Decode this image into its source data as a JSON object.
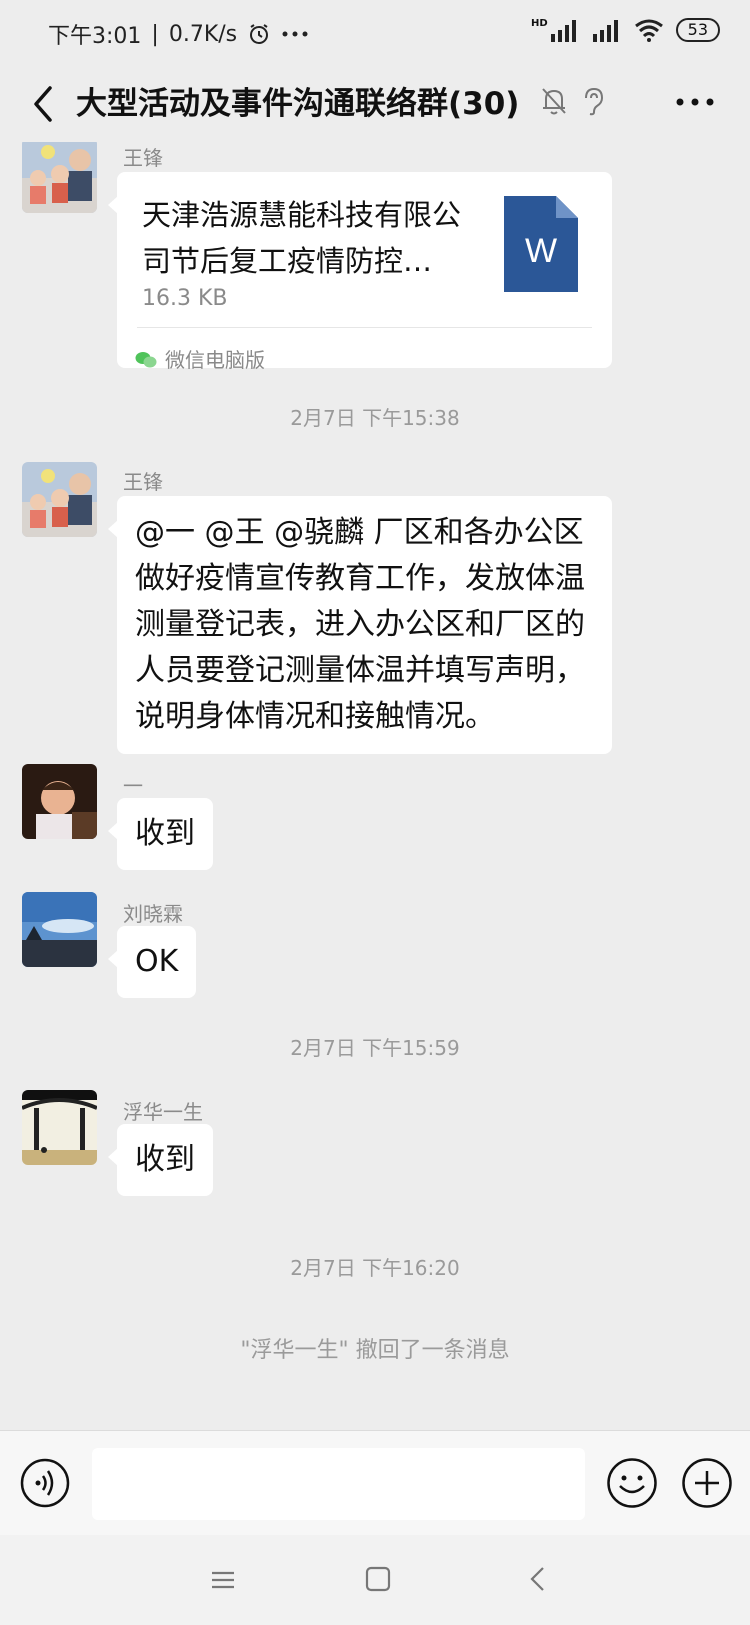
{
  "status_bar": {
    "time": "下午3:01",
    "net_speed": "0.7K/s",
    "hd_label": "HD",
    "battery": "53"
  },
  "header": {
    "title": "大型活动及事件沟通联络群(30)"
  },
  "messages": [
    {
      "sender": "王锋",
      "file_title": "天津浩源慧能科技有限公司节后复工疫情防控…",
      "file_size": "16.3 KB",
      "file_icon_letter": "W",
      "source": "微信电脑版"
    },
    {
      "sender": "王锋",
      "text": "@一 @王 @骁麟 厂区和各办公区做好疫情宣传教育工作，发放体温测量登记表，进入办公区和厂区的人员要登记测量体温并填写声明，说明身体情况和接触情况。"
    },
    {
      "sender": "一",
      "text": "收到"
    },
    {
      "sender": "刘晓霖",
      "text": "OK"
    },
    {
      "sender": "浮华一生",
      "text": "收到"
    }
  ],
  "timestamps": [
    "2月7日 下午15:38",
    "2月7日 下午15:59",
    "2月7日 下午16:20"
  ],
  "recall_notice": "\"浮华一生\" 撤回了一条消息",
  "colors": {
    "chat_bg": "#ededed",
    "bubble_bg": "#ffffff",
    "word_blue": "#2b5797",
    "meta_text": "#9a9a9a"
  }
}
